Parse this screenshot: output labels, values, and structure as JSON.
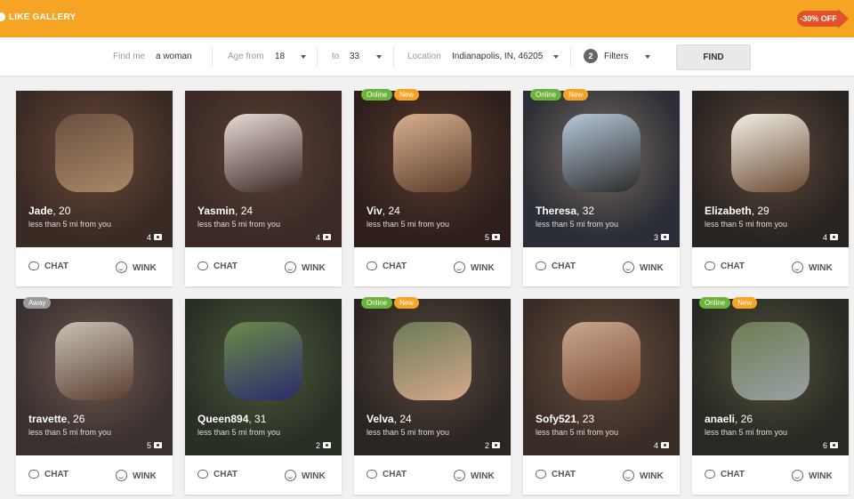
{
  "header": {
    "brand": "LIKE GALLERY",
    "promo": "-30% OFF"
  },
  "filters": {
    "find_me_label": "Find me",
    "find_me_value": "a woman",
    "age_from_label": "Age from",
    "age_from_value": "18",
    "to_label": "to",
    "to_value": "33",
    "location_label": "Location",
    "location_value": "Indianapolis, IN, 46205",
    "filters_count": "2",
    "filters_label": "Filters",
    "find_button": "FIND"
  },
  "actions": {
    "chat": "CHAT",
    "wink": "WINK"
  },
  "profiles": [
    {
      "name": "Jade",
      "age": ", 20",
      "distance": "less than 5 mi from you",
      "photos": "4"
    },
    {
      "name": "Yasmin",
      "age": ", 24",
      "distance": "less than 5 mi from you",
      "photos": "4"
    },
    {
      "name": "Viv",
      "age": ", 24",
      "distance": "less than 5 mi from you",
      "photos": "5",
      "tags": [
        "Online",
        "New"
      ]
    },
    {
      "name": "Theresa",
      "age": ", 32",
      "distance": "less than 5 mi from you",
      "photos": "3",
      "tags": [
        "Online",
        "New"
      ]
    },
    {
      "name": "Elizabeth",
      "age": ", 29",
      "distance": "less than 5 mi from you",
      "photos": "4"
    },
    {
      "name": "travette",
      "age": ", 26",
      "distance": "less than 5 mi from you",
      "photos": "5",
      "tags": [
        "Away"
      ]
    },
    {
      "name": "Queen894",
      "age": ", 31",
      "distance": "less than 5 mi from you",
      "photos": "2"
    },
    {
      "name": "Velva",
      "age": ", 24",
      "distance": "less than 5 mi from you",
      "photos": "2",
      "tags": [
        "Online",
        "New"
      ]
    },
    {
      "name": "Sofy521",
      "age": ", 23",
      "distance": "less than 5 mi from you",
      "photos": "4"
    },
    {
      "name": "anaeli",
      "age": ", 26",
      "distance": "less than 5 mi from you",
      "photos": "6",
      "tags": [
        "Online",
        "New"
      ]
    }
  ]
}
